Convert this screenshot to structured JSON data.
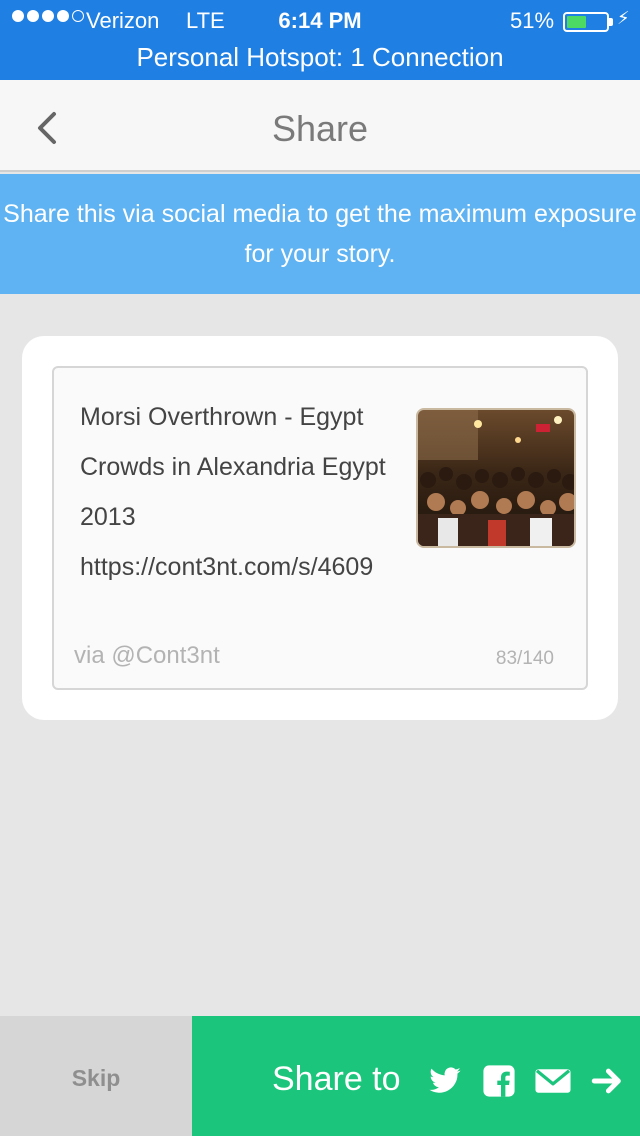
{
  "status": {
    "carrier": "Verizon",
    "network": "LTE",
    "time": "6:14 PM",
    "battery": "51%",
    "battery_level": 0.51,
    "hotspot": "Personal Hotspot: 1 Connection"
  },
  "nav": {
    "title": "Share",
    "back_icon": "chevron-left-icon"
  },
  "banner": {
    "text": "Share this via social media to get the maximum exposure for your story."
  },
  "compose": {
    "text": "Morsi Overthrown - Egypt Crowds in Alexandria Egypt 2013 https://cont3nt.com/s/4609",
    "via": "via @Cont3nt",
    "count": "83/140"
  },
  "bottom": {
    "skip": "Skip",
    "share_label": "Share to",
    "icons": [
      "twitter-icon",
      "facebook-icon",
      "email-icon",
      "arrow-right-icon"
    ]
  },
  "colors": {
    "status_bg": "#1f7fe3",
    "banner_bg": "#5fb3f2",
    "share_bg": "#1bc57c"
  }
}
